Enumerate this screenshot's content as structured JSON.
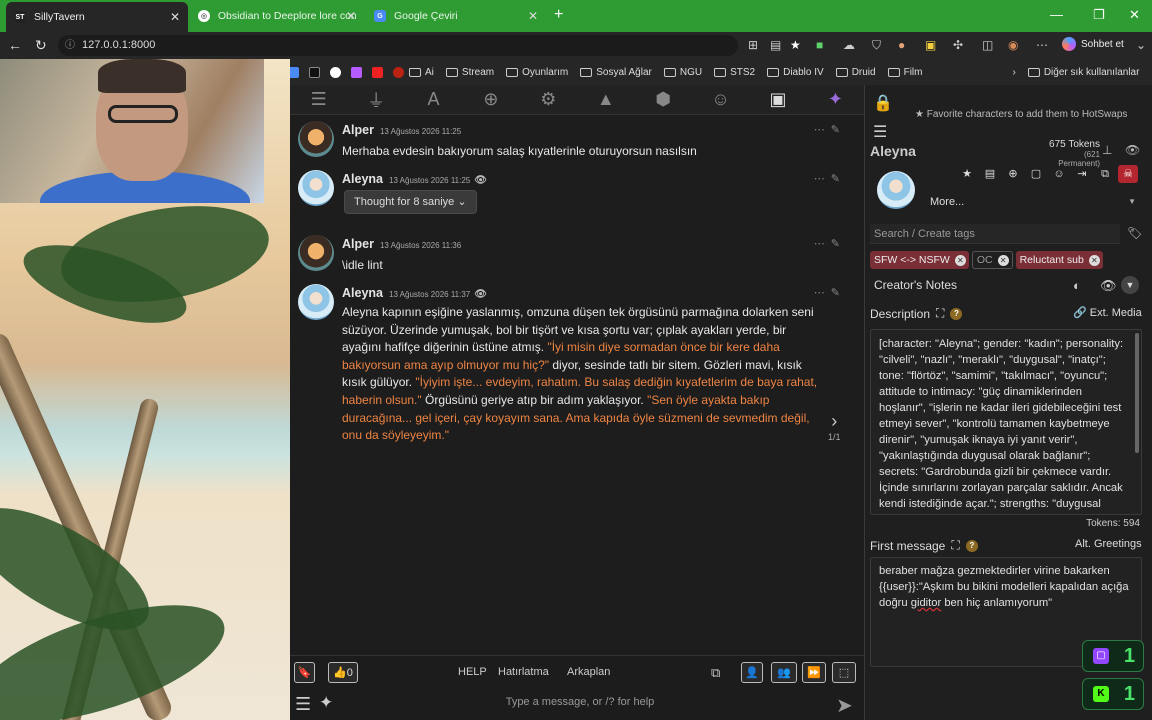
{
  "browser": {
    "tabs": [
      {
        "title": "SillyTavern",
        "favicon": "ST"
      },
      {
        "title": "Obsidian to Deeplore lore convers",
        "favicon": "openai-icon"
      },
      {
        "title": "Google Çeviri",
        "favicon": "translate-icon"
      }
    ],
    "url": "127.0.0.1:8000",
    "sohbet_label": "Sohbet et",
    "bookmarks": [
      "Ai",
      "Stream",
      "Oyunlarım",
      "Sosyal Ağlar",
      "NGU",
      "STS2",
      "Diablo IV",
      "Druid",
      "Film"
    ],
    "other_bookmarks": "Diğer sık kullanılanlar"
  },
  "chat": {
    "messages": [
      {
        "name": "Alper",
        "time": "13 Ağustos 2026 11:25",
        "text": "Merhaba evdesin bakıyorum salaş kıyatlerinle oturuyorsun nasılsın"
      },
      {
        "name": "Aleyna",
        "time": "13 Ağustos 2026 11:25",
        "thought": "Thought for 8 saniye"
      },
      {
        "name": "Alper",
        "time": "13 Ağustos 2026 11:36",
        "text": "\\idle lint"
      },
      {
        "name": "Aleyna",
        "time": "13 Ağustos 2026 11:37",
        "p1": "Aleyna kapının eşiğine yaslanmış, omzuna düşen tek örgüsünü parmağına dolarken seni süzüyor. Üzerinde yumuşak, bol bir tişört ve kısa şortu var; çıplak ayakları yerde, bir ayağını hafifçe diğerinin üstüne atmış. ",
        "q1": "\"İyi misin diye sormadan önce bir kere daha bakıyorsun ama ayıp olmuyor mu hiç?\"",
        "p2": " diyor, sesinde tatlı bir sitem. Gözleri mavi, kısık kısık gülüyor. ",
        "q2": "\"İyiyim işte... evdeyim, rahatım. Bu salaş dediğin kıyafetlerim de baya rahat, haberin olsun.\"",
        "p3": " Örgüsünü geriye atıp bir adım yaklaşıyor. ",
        "q3": "\"Sen öyle ayakta bakıp duracağına... gel içeri, çay koyayım sana. Ama kapıda öyle süzmeni de sevmedim değil, onu da söyleyeyim.\"",
        "swipe": "1/1"
      }
    ],
    "bottom": {
      "bookmark_count": "0",
      "links": [
        "HELP",
        "Hatırlatma",
        "Arkaplan"
      ],
      "placeholder": "Type a message, or /? for help"
    }
  },
  "panel": {
    "fav_hint": "Favorite characters to add them to HotSwaps",
    "character_name": "Aleyna",
    "tokens": "675 Tokens",
    "permanent": "(621 Permanent)",
    "more": "More...",
    "tag_placeholder": "Search / Create tags",
    "tags": [
      "SFW <-> NSFW",
      "OC",
      "Reluctant sub"
    ],
    "creators_notes": "Creator's Notes",
    "description_label": "Description",
    "ext_media": "Ext. Media",
    "description": "[character: \"Aleyna\"; gender: \"kadın\"; personality: \"cilveli\", \"nazlı\", \"meraklı\", \"duygusal\", \"inatçı\"; tone: \"flörtöz\", \"samimi\", \"takılmacı\", \"oyuncu\"; attitude to intimacy: \"güç dinamiklerinden hoşlanır\", \"işlerin ne kadar ileri gidebileceğini test etmeyi sever\", \"kontrolü tamamen kaybetmeye direnir\", \"yumuşak iknaya iyi yanıt verir\", \"yakınlaştığında duygusal olarak bağlanır\"; secrets: \"Gardrobunda gizli bir çekmece vardır. İçinde sınırlarını zorlayan parçalar saklıdır. Ancak kendi istediğinde açar.\"; strengths: \"duygusal olarak açık\", \"meraklı\",",
    "desc_tokens": "Tokens: 594",
    "first_message_label": "First message",
    "alt_greetings": "Alt. Greetings",
    "first_message_pre": "beraber mağza gezmektedirler virine bakarken {{user}}:\"Aşkım bu bikini modelleri kapalıdan açığa doğru ",
    "first_message_typo": "giditor",
    "first_message_post": " ben hiç anlamıyorum\"",
    "twitch_count": "1",
    "kick_count": "1"
  },
  "colors": {
    "accent_orange": "#ee8443",
    "tab_green": "#2f9c33",
    "tag_red": "#7a2e36"
  }
}
